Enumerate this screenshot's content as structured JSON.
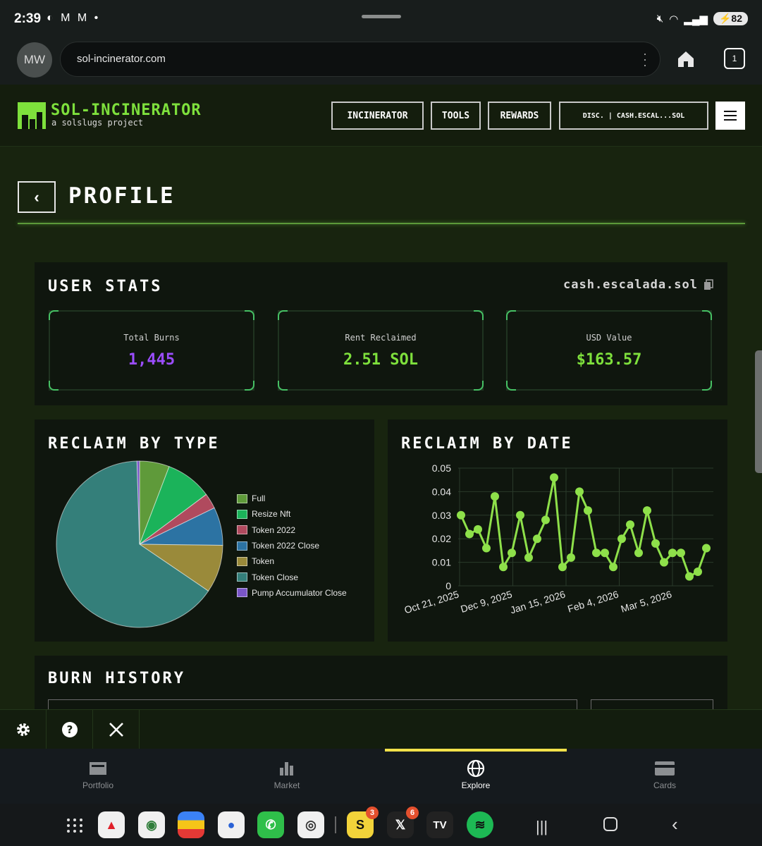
{
  "status_bar": {
    "time": "2:39",
    "battery": "82"
  },
  "browser": {
    "avatar_initials": "MW",
    "url": "sol-incinerator.com",
    "tab_count": "1"
  },
  "site": {
    "brand_name": "SOL-INCINERATOR",
    "brand_tagline": "a solslugs project",
    "nav": {
      "incinerator": "INCINERATOR",
      "tools": "TOOLS",
      "rewards": "REWARDS",
      "wallet": "DISC. | CASH.ESCAL...SOL"
    },
    "back_icon": "chevron-left-icon",
    "page_title": "PROFILE"
  },
  "user_stats": {
    "title": "USER STATS",
    "wallet": "cash.escalada.sol",
    "cards": [
      {
        "label": "Total Burns",
        "value": "1,445",
        "color": "#9b4dff"
      },
      {
        "label": "Rent Reclaimed",
        "value": "2.51 SOL",
        "color": "#7ee03c"
      },
      {
        "label": "USD Value",
        "value": "$163.57",
        "color": "#7ee03c"
      }
    ]
  },
  "reclaim_by_type": {
    "title": "RECLAIM BY TYPE",
    "chart_data": {
      "type": "pie",
      "categories": [
        "Full",
        "Resize Nft",
        "Token 2022",
        "Token 2022 Close",
        "Token",
        "Token Close",
        "Pump Accumulator Close"
      ],
      "values": [
        5.8,
        9.0,
        3.0,
        7.4,
        9.3,
        65.0,
        0.5
      ],
      "colors": [
        "#5f9a3a",
        "#1bb35a",
        "#b04a5e",
        "#2c73a3",
        "#9a8a3a",
        "#347f7a",
        "#7a56c8"
      ],
      "legend_position": "right"
    }
  },
  "reclaim_by_date": {
    "title": "RECLAIM BY DATE",
    "chart_data": {
      "type": "line",
      "x_tick_labels": [
        "Oct 21, 2025",
        "Dec 9, 2025",
        "Jan 15, 2026",
        "Feb 4, 2026",
        "Mar 5, 2026"
      ],
      "y_tick_labels": [
        "0",
        "0.01",
        "0.02",
        "0.03",
        "0.04",
        "0.05"
      ],
      "ylim": [
        0,
        0.05
      ],
      "grid": true,
      "color": "#8ee04a",
      "series": [
        {
          "values": [
            0.03,
            0.022,
            0.024,
            0.016,
            0.038,
            0.008,
            0.014,
            0.03,
            0.012,
            0.02,
            0.028,
            0.046,
            0.008,
            0.012,
            0.04,
            0.032,
            0.014,
            0.014,
            0.008,
            0.02,
            0.026,
            0.014,
            0.032,
            0.018,
            0.01,
            0.014,
            0.014,
            0.004,
            0.006,
            0.016
          ]
        }
      ]
    }
  },
  "burn_history": {
    "title": "BURN HISTORY"
  },
  "app_nav": {
    "items": [
      {
        "label": "Portfolio"
      },
      {
        "label": "Market"
      },
      {
        "label": "Explore"
      },
      {
        "label": "Cards"
      }
    ]
  },
  "dock": {
    "x_badge": "6",
    "s_badge": "3"
  }
}
